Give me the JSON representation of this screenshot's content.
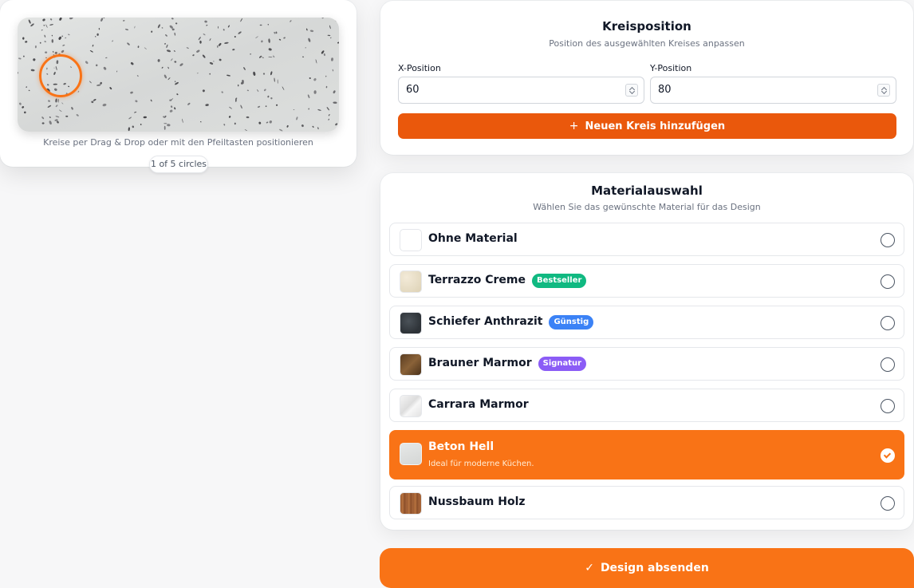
{
  "preview": {
    "hint": "Kreise per Drag & Drop oder mit den Pfeiltasten positionieren",
    "counter": "1 of 5 circles"
  },
  "position_panel": {
    "title": "Kreisposition",
    "subtitle": "Position des ausgewählten Kreises anpassen",
    "x_label": "X-Position",
    "x_value": "60",
    "y_label": "Y-Position",
    "y_value": "80",
    "add_button_icon": "plus-icon",
    "add_button": "Neuen Kreis hinzufügen"
  },
  "material_panel": {
    "title": "Materialauswahl",
    "subtitle": "Wählen Sie das gewünschte Material für das Design",
    "items": [
      {
        "name": "Ohne Material",
        "badge": "",
        "selected": false
      },
      {
        "name": "Terrazzo Creme",
        "badge": "Bestseller",
        "badge_color": "#10b981",
        "selected": false
      },
      {
        "name": "Schiefer Anthrazit",
        "badge": "Günstig",
        "badge_color": "#3b82f6",
        "selected": false
      },
      {
        "name": "Brauner Marmor",
        "badge": "Signatur",
        "badge_color": "#8b5cf6",
        "selected": false
      },
      {
        "name": "Carrara Marmor",
        "badge": "",
        "selected": false
      },
      {
        "name": "Beton Hell",
        "badge": "",
        "description": "Ideal für moderne Küchen.",
        "selected": true
      },
      {
        "name": "Nussbaum Holz",
        "badge": "",
        "selected": false
      }
    ]
  },
  "submit": {
    "icon": "check-icon",
    "label": "Design absenden"
  },
  "colors": {
    "accent": "#f97316",
    "accent_dark": "#ea580c"
  }
}
